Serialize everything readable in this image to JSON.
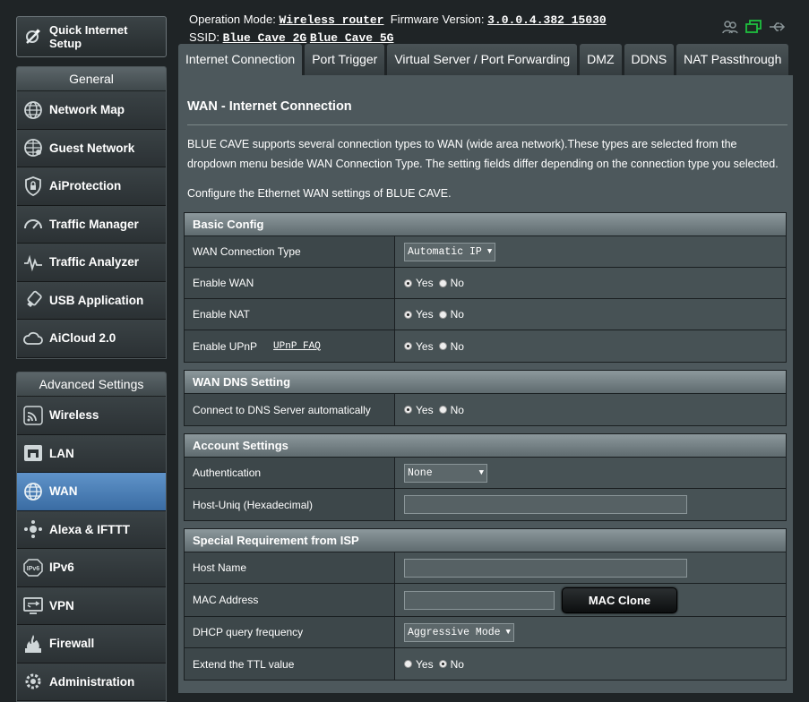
{
  "quick_setup": {
    "label": "Quick Internet\nSetup"
  },
  "general": {
    "header": "General",
    "items": [
      {
        "label": "Network Map",
        "icon": "network-map-icon"
      },
      {
        "label": "Guest Network",
        "icon": "globe-icon"
      },
      {
        "label": "AiProtection",
        "icon": "lock-shield-icon"
      },
      {
        "label": "Traffic Manager",
        "icon": "gauge-icon"
      },
      {
        "label": "Traffic Analyzer",
        "icon": "pulse-icon"
      },
      {
        "label": "USB Application",
        "icon": "usb-icon"
      },
      {
        "label": "AiCloud 2.0",
        "icon": "cloud-icon"
      }
    ]
  },
  "advanced": {
    "header": "Advanced Settings",
    "items": [
      {
        "label": "Wireless",
        "icon": "wireless-icon"
      },
      {
        "label": "LAN",
        "icon": "lan-icon"
      },
      {
        "label": "WAN",
        "icon": "globe-icon",
        "active": true
      },
      {
        "label": "Alexa & IFTTT",
        "icon": "alexa-icon"
      },
      {
        "label": "IPv6",
        "icon": "ipv6-icon"
      },
      {
        "label": "VPN",
        "icon": "vpn-icon"
      },
      {
        "label": "Firewall",
        "icon": "firewall-icon"
      },
      {
        "label": "Administration",
        "icon": "gear-icon"
      }
    ]
  },
  "top": {
    "op_mode_label": "Operation Mode:",
    "op_mode": "Wireless router",
    "firmware_label": "Firmware Version:",
    "firmware": "3.0.0.4.382_15030",
    "ssid_label": "SSID:",
    "ssid_2g": "Blue_Cave_2G",
    "ssid_5g": "Blue_Cave_5G"
  },
  "tabs": [
    "Internet Connection",
    "Port Trigger",
    "Virtual Server / Port Forwarding",
    "DMZ",
    "DDNS",
    "NAT Passthrough"
  ],
  "page": {
    "title": "WAN - Internet Connection",
    "description": "BLUE CAVE supports several connection types to WAN (wide area network).These types are selected from the dropdown menu beside WAN Connection Type. The setting fields differ depending on the connection type you selected.",
    "description2": "Configure the Ethernet WAN settings of BLUE CAVE."
  },
  "radio": {
    "yes": "Yes",
    "no": "No"
  },
  "basic": {
    "header": "Basic Config",
    "wan_type_label": "WAN Connection Type",
    "wan_type_value": "Automatic IP",
    "enable_wan": "Enable WAN",
    "enable_nat": "Enable NAT",
    "enable_upnp": "Enable UPnP",
    "upnp_faq": "UPnP  FAQ"
  },
  "dns": {
    "header": "WAN DNS Setting",
    "auto_label": "Connect to DNS Server automatically"
  },
  "account": {
    "header": "Account Settings",
    "auth_label": "Authentication",
    "auth_value": "None",
    "hostuniq_label": "Host-Uniq (Hexadecimal)"
  },
  "isp": {
    "header": "Special Requirement from ISP",
    "hostname_label": "Host Name",
    "mac_label": "MAC Address",
    "mac_clone": "MAC Clone",
    "dhcp_label": "DHCP query frequency",
    "dhcp_value": "Aggressive Mode",
    "ttl_label": "Extend the TTL value"
  }
}
